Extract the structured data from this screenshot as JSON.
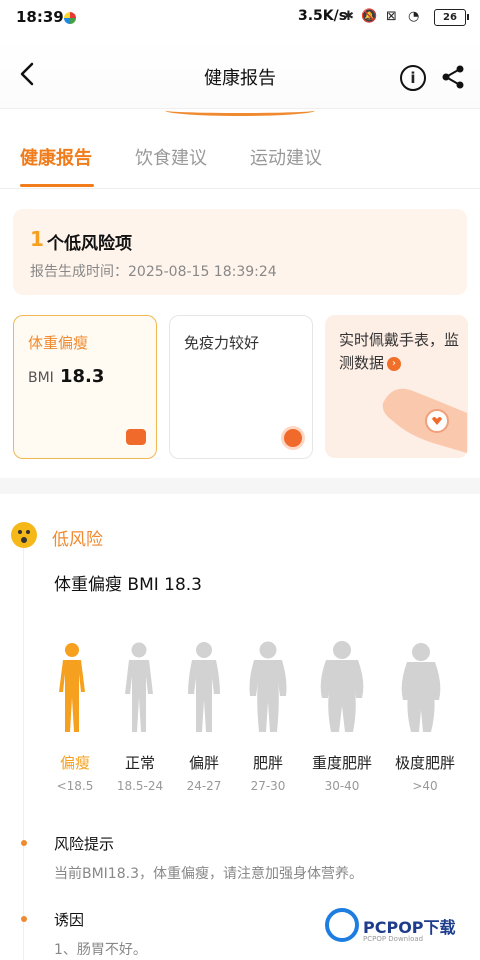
{
  "status_bar": {
    "time": "18:39",
    "net_speed": "3.5K/s",
    "battery": "26"
  },
  "header": {
    "title": "健康报告"
  },
  "tabs": [
    {
      "label": "健康报告"
    },
    {
      "label": "饮食建议"
    },
    {
      "label": "运动建议"
    }
  ],
  "summary": {
    "count": "1",
    "label": "个低风险项",
    "report_time": "报告生成时间：2025-08-15 18:39:24"
  },
  "cards": [
    {
      "title": "体重偏瘦",
      "bmi_label": "BMI",
      "bmi_value": "18.3"
    },
    {
      "title": "免疫力较好"
    },
    {
      "title": "实时佩戴手表，监测数据"
    }
  ],
  "risk_level": "低风险",
  "bmi_heading": "体重偏瘦  BMI 18.3",
  "categories": [
    {
      "name": "偏瘦",
      "range": "<18.5",
      "active": true
    },
    {
      "name": "正常",
      "range": "18.5-24"
    },
    {
      "name": "偏胖",
      "range": "24-27"
    },
    {
      "name": "肥胖",
      "range": "27-30"
    },
    {
      "name": "重度肥胖",
      "range": "30-40"
    },
    {
      "name": "极度肥胖",
      "range": ">40"
    }
  ],
  "sections": [
    {
      "title": "风险提示",
      "text": "当前BMI18.3，体重偏瘦，请注意加强身体营养。"
    },
    {
      "title": "诱因",
      "text": "1、肠胃不好。"
    }
  ],
  "watermark": {
    "text": "PCPOP下载",
    "sub": "PCPOP Download"
  },
  "colors": {
    "accent": "#f07c1b",
    "active_figure": "#f5a11f",
    "inactive_figure": "#d2d2d2"
  }
}
